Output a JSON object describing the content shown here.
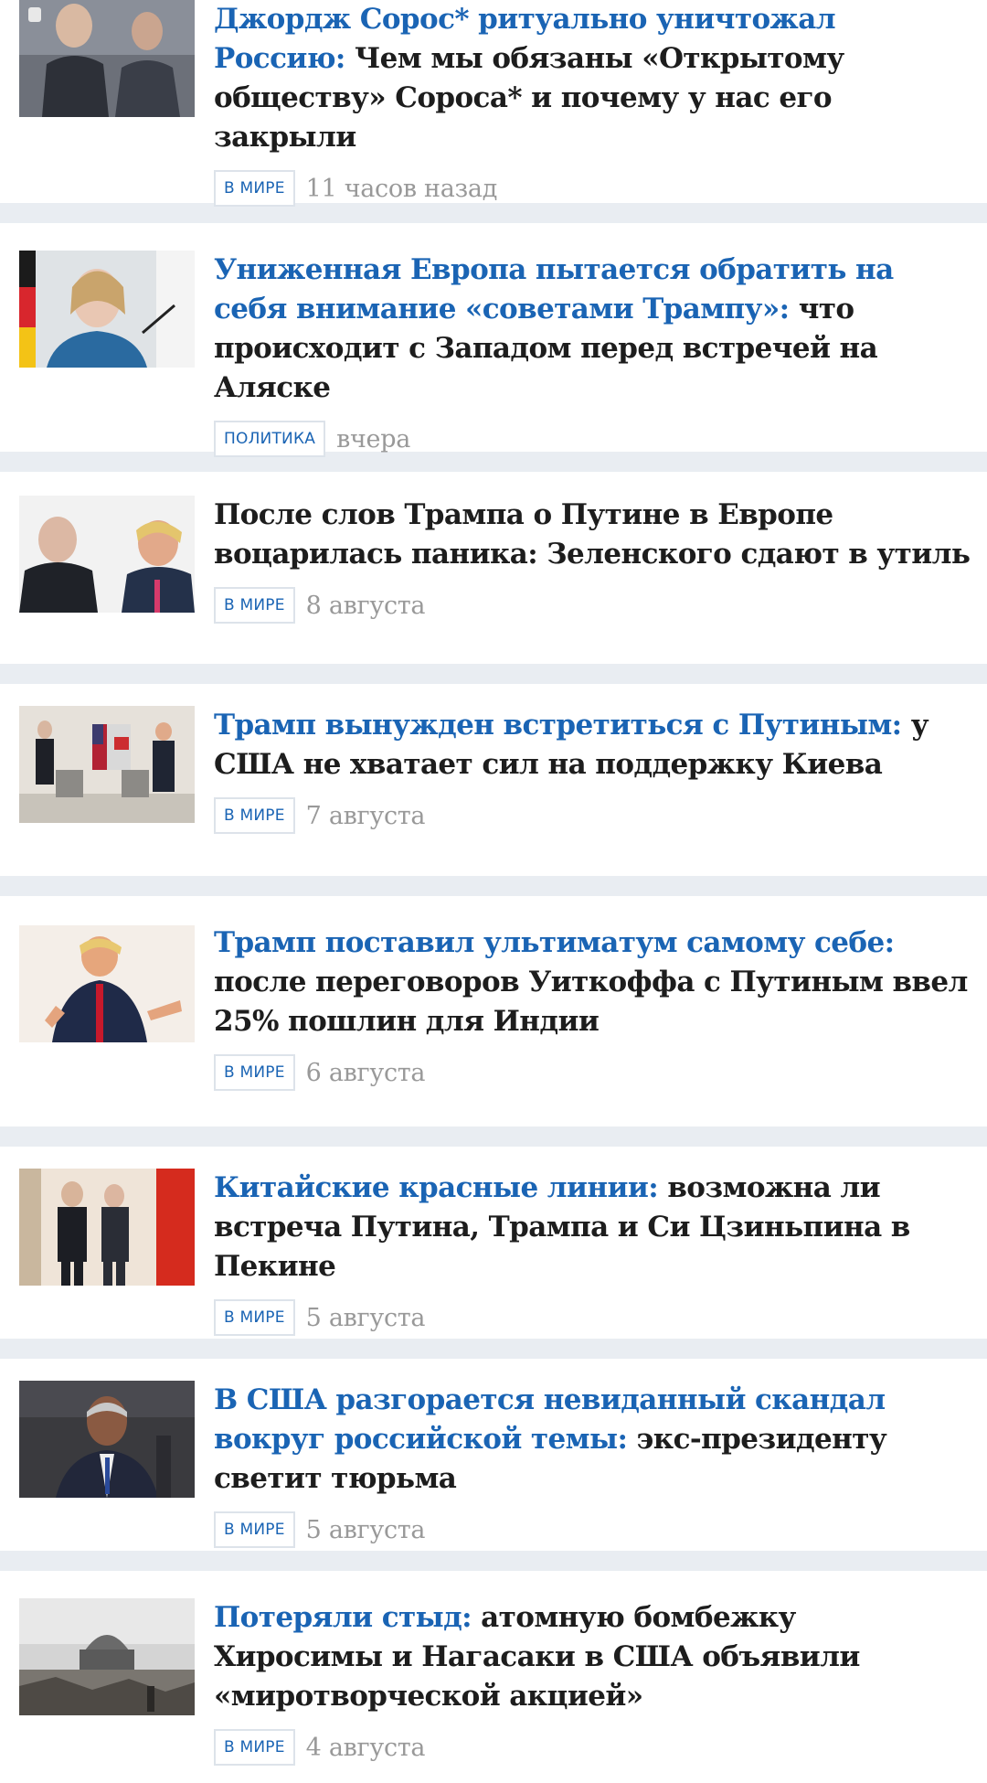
{
  "articles": [
    {
      "highlight": "Джордж Сорос* ритуально уничтожал Россию:",
      "text": "Чем мы обязаны «Открытому обществу» Сороса* и почему у нас его закрыли",
      "tag": "В МИРЕ",
      "date": "11 часов назад"
    },
    {
      "highlight": "Униженная Европа пытается обратить на себя внимание «советами Трампу»:",
      "text": "что происходит с Западом перед встречей на Аляске",
      "tag": "ПОЛИТИКА",
      "date": "вчера"
    },
    {
      "highlight": "",
      "text": "После слов Трампа о Путине в Европе воцарилась паника: Зеленского сдают в утиль",
      "tag": "В МИРЕ",
      "date": "8 августа"
    },
    {
      "highlight": "Трамп вынужден встретиться с Путиным:",
      "text": "у США не хватает сил на поддержку Киева",
      "tag": "В МИРЕ",
      "date": "7 августа"
    },
    {
      "highlight": "Трамп поставил ультиматум самому себе:",
      "text": "после переговоров Уиткоффа с Путиным ввел 25% пошлин для Индии",
      "tag": "В МИРЕ",
      "date": "6 августа"
    },
    {
      "highlight": "Китайские красные линии:",
      "text": "возможна ли встреча Путина, Трампа и Си Цзиньпина в Пекине",
      "tag": "В МИРЕ",
      "date": "5 августа"
    },
    {
      "highlight": "В США разгорается невиданный скандал вокруг российской темы:",
      "text": "экс-президенту светит тюрьма",
      "tag": "В МИРЕ",
      "date": "5 августа"
    },
    {
      "highlight": "Потеряли стыд:",
      "text": "атомную бомбежку Хиросимы и Нагасаки в США объявили «миротворческой акцией»",
      "tag": "В МИРЕ",
      "date": "4 августа"
    }
  ],
  "colors": {
    "accent": "#1a64b4",
    "headline": "#1d1d1d",
    "date": "#999999",
    "separator": "#e9edf2",
    "tag_border": "#dde3ea"
  }
}
